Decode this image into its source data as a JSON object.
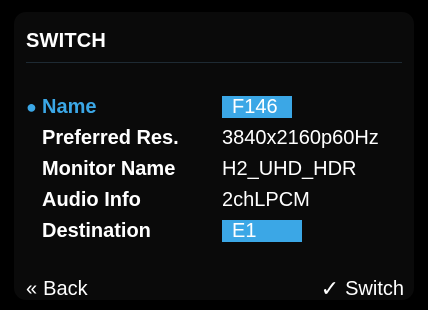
{
  "screen": {
    "title": "SWITCH",
    "fields": [
      {
        "label": "Name",
        "value": "F146",
        "selected": true
      },
      {
        "label": "Preferred Res.",
        "value": "3840x2160p60Hz"
      },
      {
        "label": "Monitor Name",
        "value": "H2_UHD_HDR"
      },
      {
        "label": "Audio Info",
        "value": "2chLPCM"
      },
      {
        "label": "Destination",
        "value": "E1"
      }
    ],
    "footer": {
      "back_label": "Back",
      "switch_label": "Switch",
      "back_icon": "double-chevron-left-icon",
      "switch_icon": "checkmark-icon"
    }
  },
  "colors": {
    "accent": "#3ba7e6",
    "background": "#000000",
    "text": "#ffffff"
  }
}
